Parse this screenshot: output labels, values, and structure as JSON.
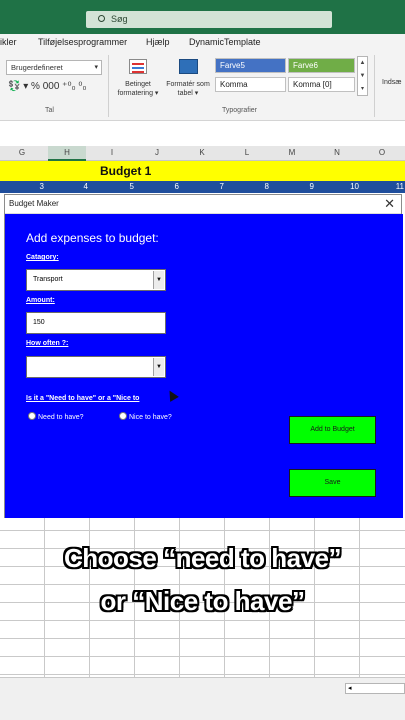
{
  "titlebar": {
    "search_placeholder": "Søg"
  },
  "menu": {
    "tabs": [
      "ikler",
      "Tilføjelsesprogrammer",
      "Hjælp",
      "DynamicTemplate"
    ]
  },
  "ribbon": {
    "number_format": "Brugerdefineret",
    "number_tools": "💱 ▾  %  000   ⁺⁰₀  ⁰₀",
    "number_group_label": "Tal",
    "conditional_formatting": "Betinget formatering ▾",
    "format_as_table": "Formatér som tabel ▾",
    "styles_group_label": "Typografier",
    "styles": [
      "Farve5",
      "Farve6",
      "Komma",
      "Komma [0]"
    ],
    "insert_label": "Indsæ"
  },
  "columns": [
    "G",
    "H",
    "I",
    "J",
    "K",
    "L",
    "M",
    "N",
    "O"
  ],
  "sheet": {
    "title_cell": "Budget 1",
    "number_row": [
      "3",
      "4",
      "5",
      "6",
      "7",
      "8",
      "9",
      "10",
      "11"
    ]
  },
  "dialog": {
    "title": "Budget Maker",
    "close_glyph": "✕",
    "heading": "Add expenses to budget:",
    "category_label": "Catagory:",
    "category_value": "Transport",
    "amount_label": "Amount:",
    "amount_value": "150",
    "how_often_label": "How often ?:",
    "how_often_value": "",
    "need_label": "Is it a \"Need to have\" or a \"Nice to",
    "radio_need": "Need to have?",
    "radio_nice": "Nice to have?",
    "add_button": "Add to Budget",
    "save_button": "Save",
    "dropdown_glyph": "▼"
  },
  "caption": {
    "line1": "Choose “need to have”",
    "line2": "or “Nice to have”"
  },
  "colors": {
    "title_green": "#1f7246",
    "dialog_blue": "#0000ff",
    "button_green": "#00ff00",
    "yellow_header": "#ffff00",
    "number_row_blue": "#1f4e9c"
  }
}
